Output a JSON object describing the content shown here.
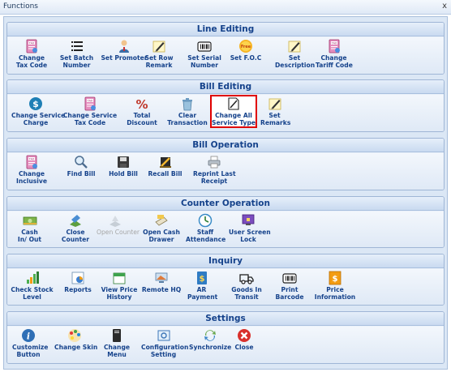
{
  "window": {
    "title": "Functions",
    "close": "x"
  },
  "groups": [
    {
      "title": "Line Editing",
      "buttons": [
        {
          "label": "Change\nTax Code",
          "icon": "tax-doc-icon"
        },
        {
          "label": "Set Batch\nNumber",
          "icon": "list-icon"
        },
        {
          "label": "Set Promoter",
          "icon": "person-icon"
        },
        {
          "label": "Set Row\nRemark",
          "icon": "note-pencil-icon"
        },
        {
          "label": "Set Serial\nNumber",
          "icon": "barcode-icon"
        },
        {
          "label": "Set F.O.C",
          "icon": "free-icon"
        },
        {
          "label": "Set\nDescription",
          "icon": "note-pencil-icon"
        },
        {
          "label": "Change\nTariff Code",
          "icon": "tax-doc-icon"
        }
      ]
    },
    {
      "title": "Bill Editing",
      "buttons": [
        {
          "label": "Change Service\nCharge",
          "icon": "dollar-icon"
        },
        {
          "label": "Change Service\nTax Code",
          "icon": "tax-doc-icon"
        },
        {
          "label": "Total\nDiscount",
          "icon": "percent-icon"
        },
        {
          "label": "Clear\nTransaction",
          "icon": "recycle-bin-icon"
        },
        {
          "label": "Change All\nService Type",
          "icon": "document-icon",
          "selected": true
        },
        {
          "label": "Set\nRemarks",
          "icon": "note-pencil-icon"
        }
      ]
    },
    {
      "title": "Bill Operation",
      "buttons": [
        {
          "label": "Change\nInclusive",
          "icon": "tax-doc-icon"
        },
        {
          "label": "Find Bill",
          "icon": "magnifier-icon"
        },
        {
          "label": "Hold Bill",
          "icon": "floppy-icon"
        },
        {
          "label": "Recall Bill",
          "icon": "recall-icon"
        },
        {
          "label": "Reprint Last\nReceipt",
          "icon": "printer-icon"
        }
      ]
    },
    {
      "title": "Counter Operation",
      "buttons": [
        {
          "label": "Cash\nIn/ Out",
          "icon": "cash-icon"
        },
        {
          "label": "Close\nCounter",
          "icon": "close-counter-icon"
        },
        {
          "label": "Open Counter",
          "icon": "open-counter-icon",
          "disabled": true
        },
        {
          "label": "Open Cash\nDrawer",
          "icon": "drawer-icon"
        },
        {
          "label": "Staff\nAttendance",
          "icon": "clock-icon"
        },
        {
          "label": "User Screen\nLock",
          "icon": "screen-lock-icon"
        }
      ]
    },
    {
      "title": "Inquiry",
      "buttons": [
        {
          "label": "Check Stock\nLevel",
          "icon": "bar-chart-icon"
        },
        {
          "label": "Reports",
          "icon": "report-icon"
        },
        {
          "label": "View Price\nHistory",
          "icon": "calendar-icon"
        },
        {
          "label": "Remote HQ",
          "icon": "remote-icon"
        },
        {
          "label": "AR\nPayment",
          "icon": "payment-icon"
        },
        {
          "label": "Goods In\nTransit",
          "icon": "transit-icon"
        },
        {
          "label": "Print\nBarcode",
          "icon": "barcode-icon"
        },
        {
          "label": "Price\nInformation",
          "icon": "price-info-icon"
        }
      ]
    },
    {
      "title": "Settings",
      "buttons": [
        {
          "label": "Customize\nButton",
          "icon": "info-icon"
        },
        {
          "label": "Change Skin",
          "icon": "palette-icon"
        },
        {
          "label": "Change\nMenu",
          "icon": "menu-icon"
        },
        {
          "label": "Configuration\nSetting",
          "icon": "config-icon"
        },
        {
          "label": "Synchronize",
          "icon": "sync-icon"
        },
        {
          "label": "Close",
          "icon": "close-icon"
        }
      ]
    }
  ],
  "colors": {
    "accent_text": "#15428b",
    "highlight_border": "#e00000"
  }
}
